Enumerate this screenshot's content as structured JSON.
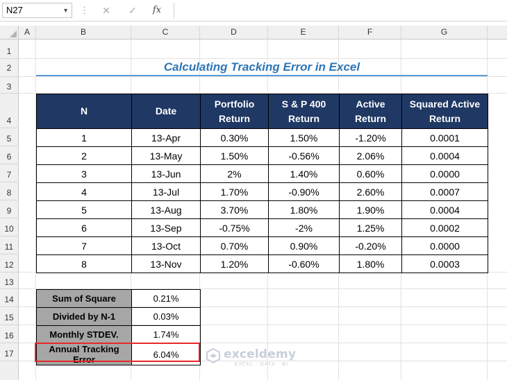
{
  "formula_bar": {
    "name_box": "N27",
    "separator": "⋮",
    "cancel": "✕",
    "confirm": "✓",
    "fx": "fx",
    "formula": ""
  },
  "columns": [
    "A",
    "B",
    "C",
    "D",
    "E",
    "F",
    "G"
  ],
  "rows": [
    "1",
    "2",
    "3",
    "4",
    "5",
    "6",
    "7",
    "8",
    "9",
    "10",
    "11",
    "12",
    "13",
    "14",
    "15",
    "16",
    "17"
  ],
  "title": "Calculating Tracking Error in Excel",
  "table": {
    "headers": [
      [
        "N",
        ""
      ],
      [
        "Date",
        ""
      ],
      [
        "Portfolio",
        "Return"
      ],
      [
        "S & P 400",
        "Return"
      ],
      [
        "Active",
        "Return"
      ],
      [
        "Squared Active",
        "Return"
      ]
    ],
    "rows": [
      [
        "1",
        "13-Apr",
        "0.30%",
        "1.50%",
        "-1.20%",
        "0.0001"
      ],
      [
        "2",
        "13-May",
        "1.50%",
        "-0.56%",
        "2.06%",
        "0.0004"
      ],
      [
        "3",
        "13-Jun",
        "2%",
        "1.40%",
        "0.60%",
        "0.0000"
      ],
      [
        "4",
        "13-Jul",
        "1.70%",
        "-0.90%",
        "2.60%",
        "0.0007"
      ],
      [
        "5",
        "13-Aug",
        "3.70%",
        "1.80%",
        "1.90%",
        "0.0004"
      ],
      [
        "6",
        "13-Sep",
        "-0.75%",
        "-2%",
        "1.25%",
        "0.0002"
      ],
      [
        "7",
        "13-Oct",
        "0.70%",
        "0.90%",
        "-0.20%",
        "0.0000"
      ],
      [
        "8",
        "13-Nov",
        "1.20%",
        "-0.60%",
        "1.80%",
        "0.0003"
      ]
    ]
  },
  "summary": [
    {
      "label": "Sum of Square",
      "value": "0.21%"
    },
    {
      "label": "Divided by N-1",
      "value": "0.03%"
    },
    {
      "label": "Monthly STDEV.",
      "value": "1.74%"
    },
    {
      "label": "Annual Tracking Error",
      "value": "6.04%"
    }
  ],
  "watermark": {
    "brand": "exceldemy",
    "tagline": "EXCEL · DATA · BI"
  },
  "colors": {
    "header_fill": "#1f3864",
    "title_color": "#2e75b6",
    "summary_fill": "#a6a6a6",
    "highlight_border": "#e8262a"
  }
}
